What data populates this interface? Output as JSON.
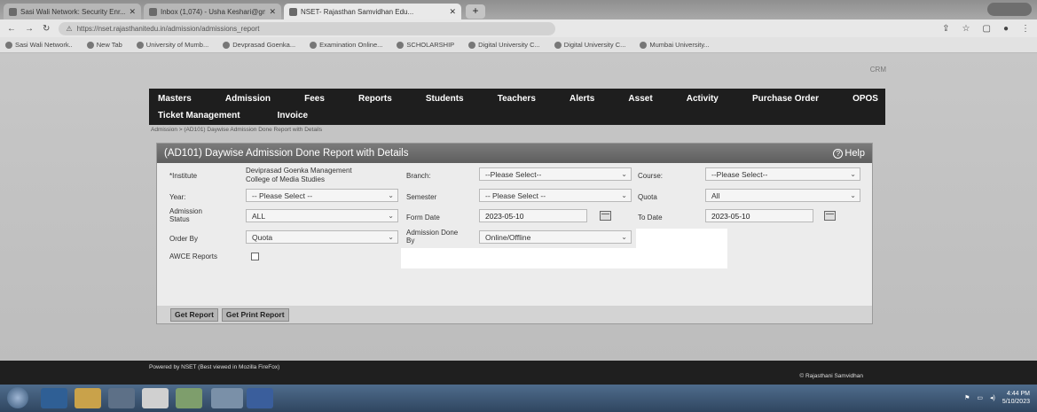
{
  "browser": {
    "tabs": [
      {
        "title": "Sasi Wali Network: Security Enr..."
      },
      {
        "title": "Inbox (1,074) - Usha Keshari@gm..."
      },
      {
        "title": "NSET- Rajasthan Samvidhan Edu..."
      }
    ],
    "new_tab_label": "+",
    "url": "https://nset.rajasthanitedu.in/admission/admissions_report",
    "bookmarks": [
      "Sasi Wali Network..",
      "New Tab",
      "University of Mumb...",
      "Devprasad Goenka...",
      "Examination Online...",
      "SCHOLARSHIP",
      "Digital University C...",
      "Digital University C...",
      "Mumbai University..."
    ]
  },
  "page": {
    "crm_label": "CRM",
    "nav_row1": [
      "Masters",
      "Admission",
      "Fees",
      "Reports",
      "Students",
      "Teachers",
      "Alerts",
      "Asset",
      "Activity",
      "Purchase Order",
      "OPOS"
    ],
    "nav_row2": [
      "Ticket Management",
      "Invoice"
    ],
    "breadcrumb": "Admission > (AD101) Daywise Admission Done Report with Details",
    "panel": {
      "title": "(AD101) Daywise Admission Done Report with Details",
      "help_label": "Help",
      "institute_label": "*Institute",
      "institute_value_line1": "Deviprasad Goenka Management",
      "institute_value_line2": "College of Media Studies",
      "branch_label": "Branch:",
      "branch_value": "--Please Select--",
      "course_label": "Course:",
      "course_value": "--Please Select--",
      "year_label": "Year:",
      "year_value": "-- Please Select --",
      "semester_label": "Semester",
      "semester_value": "-- Please Select --",
      "quota_label": "Quota",
      "quota_value": "All",
      "admission_status_label_1": "Admission",
      "admission_status_label_2": "Status",
      "admission_status_value": "ALL",
      "form_date_label": "Form Date",
      "form_date_value": "2023-05-10",
      "to_date_label": "To Date",
      "to_date_value": "2023-05-10",
      "order_by_label": "Order By",
      "order_by_value": "Quota",
      "admission_done_by_label_1": "Admission Done",
      "admission_done_by_label_2": "By",
      "admission_done_by_value": "Online/Offline",
      "awce_label": "AWCE Reports",
      "get_report_label": "Get Report",
      "get_print_report_label": "Get Print Report"
    },
    "footer_left": "Powered by NSET (Best viewed in Mozilla FireFox)",
    "footer_right": "© Rajasthani Samvidhan"
  },
  "taskbar": {
    "time": "4:44 PM",
    "date": "5/10/2023"
  }
}
